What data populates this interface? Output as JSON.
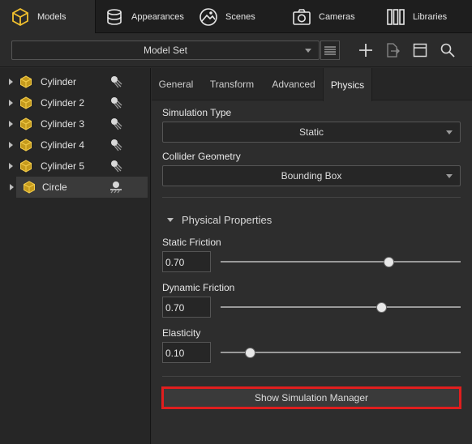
{
  "top_tabs": [
    {
      "label": "Models",
      "icon": "cube-icon",
      "active": true
    },
    {
      "label": "Appearances",
      "icon": "spheres-icon"
    },
    {
      "label": "Scenes",
      "icon": "scene-icon"
    },
    {
      "label": "Cameras",
      "icon": "camera-icon"
    },
    {
      "label": "Libraries",
      "icon": "library-icon"
    }
  ],
  "toolbar": {
    "model_set": "Model Set",
    "icons": [
      "list-icon",
      "add-icon",
      "import-icon",
      "window-icon",
      "search-icon"
    ]
  },
  "tree": {
    "items": [
      {
        "label": "Cylinder",
        "icon": "cube-icon",
        "status_icon": "physics-dynamic-icon"
      },
      {
        "label": "Cylinder 2",
        "icon": "cube-icon",
        "status_icon": "physics-dynamic-icon"
      },
      {
        "label": "Cylinder 3",
        "icon": "cube-icon",
        "status_icon": "physics-dynamic-icon"
      },
      {
        "label": "Cylinder 4",
        "icon": "cube-icon",
        "status_icon": "physics-dynamic-icon"
      },
      {
        "label": "Cylinder 5",
        "icon": "cube-icon",
        "status_icon": "physics-dynamic-icon"
      },
      {
        "label": "Circle",
        "icon": "cube-icon",
        "status_icon": "physics-static-icon",
        "selected": true
      }
    ]
  },
  "panel": {
    "tabs": [
      "General",
      "Transform",
      "Advanced",
      "Physics"
    ],
    "active_tab": "Physics",
    "simulation_type_label": "Simulation Type",
    "simulation_type_value": "Static",
    "collider_label": "Collider Geometry",
    "collider_value": "Bounding Box",
    "section_title": "Physical Properties",
    "static_friction_label": "Static Friction",
    "static_friction_value": "0.70",
    "dynamic_friction_label": "Dynamic Friction",
    "dynamic_friction_value": "0.70",
    "elasticity_label": "Elasticity",
    "elasticity_value": "0.10",
    "sim_manager_button": "Show Simulation Manager",
    "highlight_color": "#e01e1e"
  }
}
